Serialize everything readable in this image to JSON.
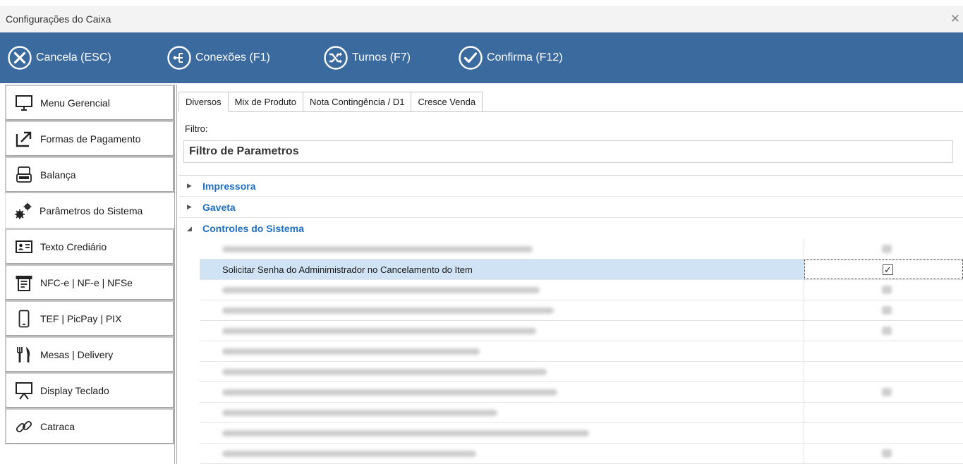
{
  "window": {
    "title": "Configurações do Caixa",
    "close_glyph": "✕"
  },
  "toolbar": {
    "cancel": {
      "text": "Cancela (ESC)",
      "icon": "x-circle-icon"
    },
    "connections": {
      "text": "Conexões (F1)",
      "icon": "network-icon"
    },
    "shifts": {
      "text": "Turnos (F7)",
      "icon": "shuffle-icon"
    },
    "confirm": {
      "text": "Confirma (F12)",
      "icon": "check-circle-icon"
    }
  },
  "sidebar": {
    "items": [
      {
        "label": "Menu Gerencial",
        "icon": "monitor-icon"
      },
      {
        "label": "Formas de Pagamento",
        "icon": "external-link-icon"
      },
      {
        "label": "Balança",
        "icon": "scale-icon"
      },
      {
        "label": "Parâmetros do Sistema",
        "icon": "gears-icon",
        "active": true
      },
      {
        "label": "Texto Crediário",
        "icon": "id-card-icon"
      },
      {
        "label": "NFC-e | NF-e | NFSe",
        "icon": "receipt-icon"
      },
      {
        "label": "TEF | PicPay | PIX",
        "icon": "smartphone-icon"
      },
      {
        "label": "Mesas | Delivery",
        "icon": "cutlery-icon"
      },
      {
        "label": "Display Teclado",
        "icon": "display-icon"
      },
      {
        "label": "Catraca",
        "icon": "link-icon"
      }
    ]
  },
  "tabs": [
    "Diversos",
    "Mix de Produto",
    "Nota Contingência / D1",
    "Cresce Venda"
  ],
  "active_tab": "Diversos",
  "filter": {
    "label": "Filtro:",
    "value": "Filtro de Parametros"
  },
  "groups": [
    {
      "name": "Impressora",
      "expanded": false,
      "arrow": "▶"
    },
    {
      "name": "Gaveta",
      "expanded": false,
      "arrow": "▶"
    },
    {
      "name": "Controles do Sistema",
      "expanded": true,
      "arrow": "◢"
    }
  ],
  "selected_row": {
    "label": "Solicitar Senha do Adminimistrador no Cancelamento do Item",
    "checked": true,
    "check_glyph": "✓"
  },
  "colors": {
    "toolbar_bg": "#3a6a9e",
    "group_text": "#1f6fc0",
    "selected_row_bg": "#cfe3f5"
  }
}
